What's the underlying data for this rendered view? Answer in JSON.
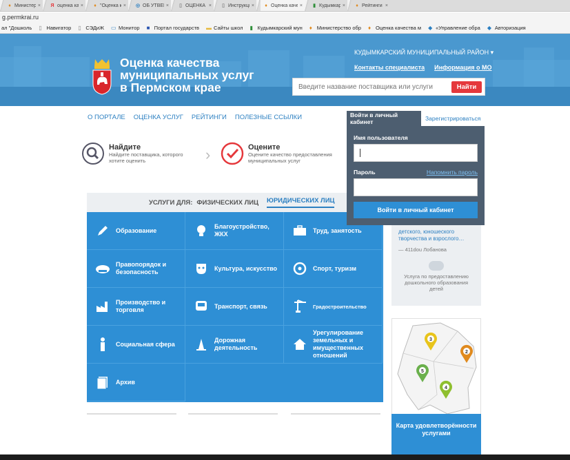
{
  "browser": {
    "tabs": [
      {
        "title": "Министерство",
        "icon": "edu-favicon"
      },
      {
        "title": "оценка качеств",
        "icon": "yandex-favicon"
      },
      {
        "title": "\"Оценка качест",
        "icon": "edu-favicon"
      },
      {
        "title": "ОБ УТВЕРЖДЕН",
        "icon": "gov-favicon"
      },
      {
        "title": "ОЦЕНКА КАЧЕ",
        "icon": "page-favicon"
      },
      {
        "title": "Инструкция по",
        "icon": "page-favicon"
      },
      {
        "title": "Оценка качест",
        "icon": "edu-favicon",
        "active": true
      },
      {
        "title": "Кудымкарский",
        "icon": "school-favicon"
      },
      {
        "title": "Рейтинги - Оц",
        "icon": "edu-favicon"
      }
    ],
    "address": "g.permkrai.ru",
    "bookmarks": [
      {
        "label": "ал \"Дошколь",
        "icon": ""
      },
      {
        "label": "Навигатор",
        "icon": "page-icon"
      },
      {
        "label": "СЭДиЖ",
        "icon": "page-icon"
      },
      {
        "label": "Монитор",
        "icon": "monitor-icon"
      },
      {
        "label": "Портал государств",
        "icon": "flag-icon"
      },
      {
        "label": "Сайты школ",
        "icon": "folder-icon"
      },
      {
        "label": "Кудымкарский мун",
        "icon": "school-icon"
      },
      {
        "label": "Министерство обр",
        "icon": "edu-icon"
      },
      {
        "label": "Оценка качества м",
        "icon": "edu-icon"
      },
      {
        "label": "«Управление обра",
        "icon": "diamond-icon"
      },
      {
        "label": "Авторизация",
        "icon": "diamond-icon"
      }
    ]
  },
  "header": {
    "title_line1": "Оценка качества",
    "title_line2": "муниципальных услуг",
    "title_line3": "в Пермском крае",
    "region": "КУДЫМКАРСКИЙ МУНИЦИПАЛЬНЫЙ РАЙОН ▾",
    "link_contacts": "Контакты специалиста",
    "link_info": "Информация о МО",
    "search_placeholder": "Введите название поставщика или услуги",
    "search_button": "Найти"
  },
  "nav": [
    "О ПОРТАЛЕ",
    "ОЦЕНКА УСЛУГ",
    "РЕЙТИНГИ",
    "ПОЛЕЗНЫЕ ССЫЛКИ"
  ],
  "steps": [
    {
      "title": "Найдите",
      "text": "Найдите поставщика, которого хотите оценить"
    },
    {
      "title": "Оцените",
      "text": "Оцените качество предоставления муниципальных услуг"
    }
  ],
  "services": {
    "label": "УСЛУГИ ДЛЯ:",
    "tab_individuals": "ФИЗИЧЕСКИХ ЛИЦ",
    "tab_legal": "ЮРИДИЧЕСКИХ ЛИЦ",
    "items": [
      {
        "label": "Образование",
        "icon": "pencil-icon"
      },
      {
        "label": "Благоустройство, ЖКХ",
        "icon": "lightbulb-icon"
      },
      {
        "label": "Труд, занятость",
        "icon": "briefcase-icon"
      },
      {
        "label": "Правопорядок и безопасность",
        "icon": "police-cap-icon"
      },
      {
        "label": "Культура, искусство",
        "icon": "mask-icon"
      },
      {
        "label": "Спорт, туризм",
        "icon": "sport-icon"
      },
      {
        "label": "Производство и торговля",
        "icon": "factory-icon"
      },
      {
        "label": "Транспорт, связь",
        "icon": "bus-icon"
      },
      {
        "label": "Градостроительство",
        "icon": "crane-icon"
      },
      {
        "label": "Социальная сфера",
        "icon": "person-icon"
      },
      {
        "label": "Дорожная деятельность",
        "icon": "cone-icon"
      },
      {
        "label": "Урегулирование земельных и имущественных отношений",
        "icon": "house-icon"
      },
      {
        "label": "Архив",
        "icon": "archive-icon"
      }
    ]
  },
  "login": {
    "tab_login": "Войти в личный кабинет",
    "tab_register": "Зарегистрироваться",
    "username_label": "Имя пользователя",
    "password_label": "Пароль",
    "remind_link": "Напомнить пароль",
    "submit": "Войти в личный кабинет"
  },
  "review": {
    "text": "детского, юношеского творчества и взрослого…",
    "author": "— 411dou Лобанова",
    "service": "Услуга по предоставлению дошкольного образования детей"
  },
  "map": {
    "markers": [
      "3",
      "2",
      "5",
      "4"
    ],
    "caption": "Карта удовлетворённости услугами",
    "colors": {
      "3": "#e8c41c",
      "2": "#e08a1e",
      "5": "#6ab04c",
      "4": "#8fbf2f"
    }
  },
  "colors": {
    "accent": "#2e8fd5",
    "hero": "#4a98cf",
    "danger": "#e5383c",
    "login_bg": "#4d5e70"
  }
}
